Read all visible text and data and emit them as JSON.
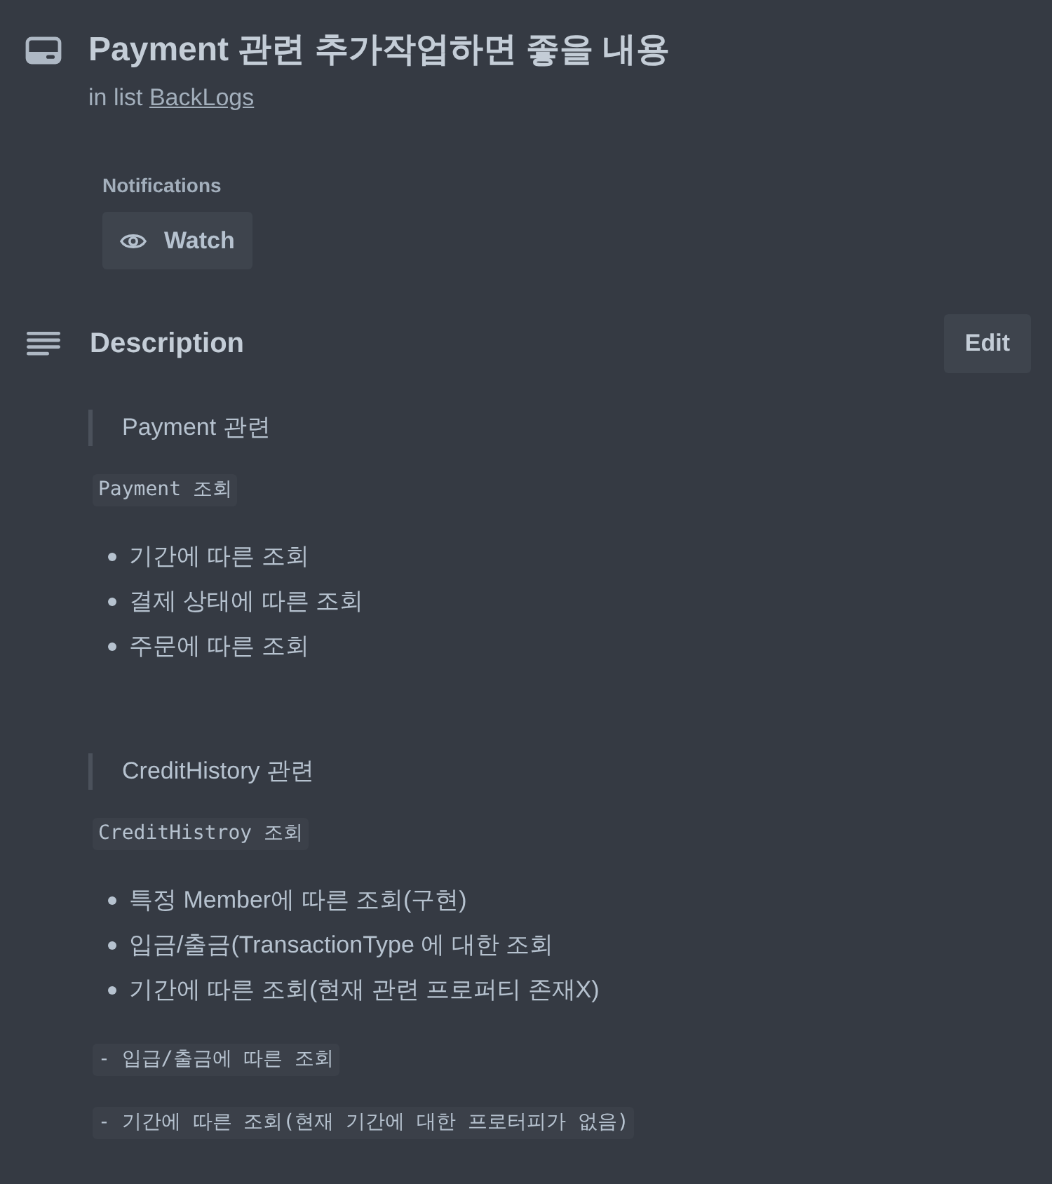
{
  "card": {
    "title": "Payment 관련 추가작업하면 좋을 내용",
    "list_prefix": "in list",
    "list_name": "BackLogs"
  },
  "notifications": {
    "label": "Notifications",
    "watch_button": "Watch"
  },
  "description": {
    "heading": "Description",
    "edit_button": "Edit",
    "blocks": [
      {
        "kind": "quote",
        "text": "Payment 관련"
      },
      {
        "kind": "code",
        "text": "Payment 조회"
      },
      {
        "kind": "list",
        "items": [
          "기간에 따른 조회",
          "결제 상태에 따른 조회",
          "주문에 따른 조회"
        ]
      },
      {
        "kind": "quote",
        "text": "CreditHistory 관련"
      },
      {
        "kind": "code",
        "text": "CreditHistroy 조회"
      },
      {
        "kind": "list",
        "items": [
          "특정 Member에 따른 조회(구현)",
          "입금/출금(TransactionType 에 대한 조회",
          "기간에 따른 조회(현재 관련 프로퍼티 존재X)"
        ]
      },
      {
        "kind": "code",
        "text": "- 입급/출금에 따른 조회"
      },
      {
        "kind": "code",
        "text": "- 기간에 따른 조회(현재 기간에 대한 프로터피가 없음)"
      }
    ]
  }
}
